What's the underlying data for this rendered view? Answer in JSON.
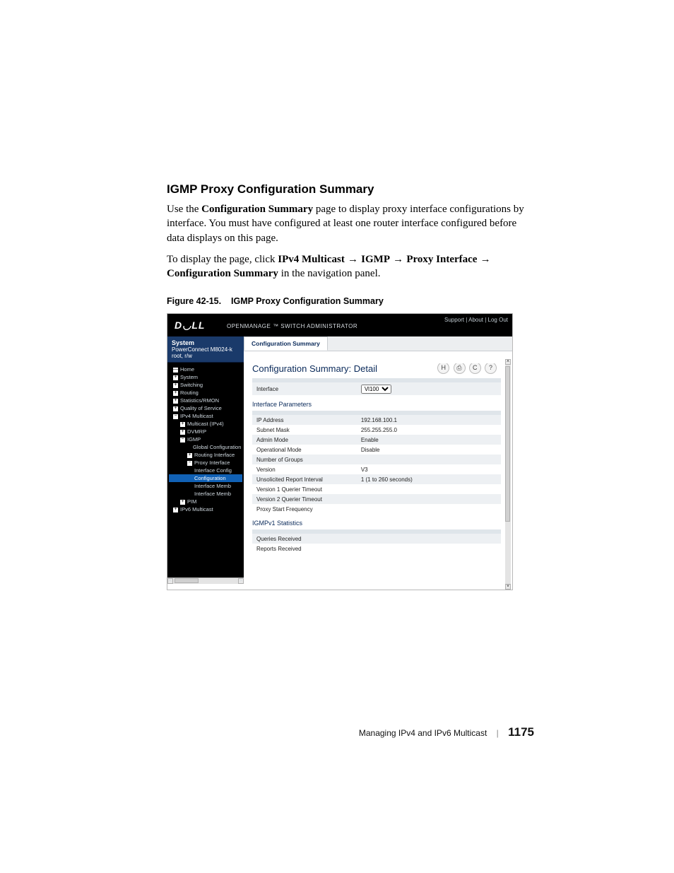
{
  "heading": "IGMP Proxy Configuration Summary",
  "para1_a": "Use the ",
  "para1_b": "Configuration Summary",
  "para1_c": " page to display proxy interface configurations by interface. You must have configured at least one router interface configured before data displays on this page.",
  "para2_a": "To display the page, click ",
  "para2_b": "IPv4 Multicast",
  "arrow": " → ",
  "para2_c": "IGMP",
  "para2_d": "Proxy Interface",
  "para2_e": "Configuration Summary",
  "para2_f": " in the navigation panel.",
  "figcap_a": "Figure 42-15.",
  "figcap_b": "IGMP Proxy Configuration Summary",
  "top": {
    "links": "Support  |  About  |  Log Out",
    "logo": "D◡LL",
    "sublogo": "OPENMANAGE ™ SWITCH ADMINISTRATOR"
  },
  "sys": {
    "title": "System",
    "sub": "PowerConnect M8024-k",
    "user": "root, r/w"
  },
  "tree": {
    "home": "Home",
    "system": "System",
    "switching": "Switching",
    "routing": "Routing",
    "stats": "Statistics/RMON",
    "qos": "Quality of Service",
    "ipv4m": "IPv4 Multicast",
    "mcast4": "Multicast (IPv4)",
    "dvmrp": "DVMRP",
    "igmp": "IGMP",
    "globconf": "Global Configuration",
    "routingif": "Routing Interface",
    "proxyif": "Proxy Interface",
    "ifconf": "Interface Config",
    "confmember": "Configuration",
    "ifmemb1": "Interface Memb",
    "ifmemb2": "Interface Memb",
    "pim": "PIM",
    "ipv6m": "IPv6 Multicast"
  },
  "tab": "Configuration Summary",
  "ctitle": "Configuration Summary: Detail",
  "icons": {
    "save": "H",
    "print": "⎙",
    "refresh": "C",
    "help": "?"
  },
  "iface_label": "Interface",
  "iface_val": "Vl100",
  "sec1": "Interface Parameters",
  "rows1": [
    {
      "k": "IP Address",
      "v": "192.168.100.1"
    },
    {
      "k": "Subnet Mask",
      "v": "255.255.255.0"
    },
    {
      "k": "Admin Mode",
      "v": "Enable"
    },
    {
      "k": "Operational Mode",
      "v": "Disable"
    },
    {
      "k": "Number of Groups",
      "v": ""
    },
    {
      "k": "Version",
      "v": "V3"
    },
    {
      "k": "Unsolicited Report Interval",
      "v": "1  (1 to 260 seconds)"
    },
    {
      "k": "Version 1 Querier Timeout",
      "v": ""
    },
    {
      "k": "Version 2 Querier Timeout",
      "v": ""
    },
    {
      "k": "Proxy Start Frequency",
      "v": ""
    }
  ],
  "sec2": "IGMPv1 Statistics",
  "rows2": [
    {
      "k": "Queries Received",
      "v": ""
    },
    {
      "k": "Reports Received",
      "v": ""
    }
  ],
  "footer": {
    "chapter": "Managing IPv4 and IPv6 Multicast",
    "page": "1175"
  }
}
